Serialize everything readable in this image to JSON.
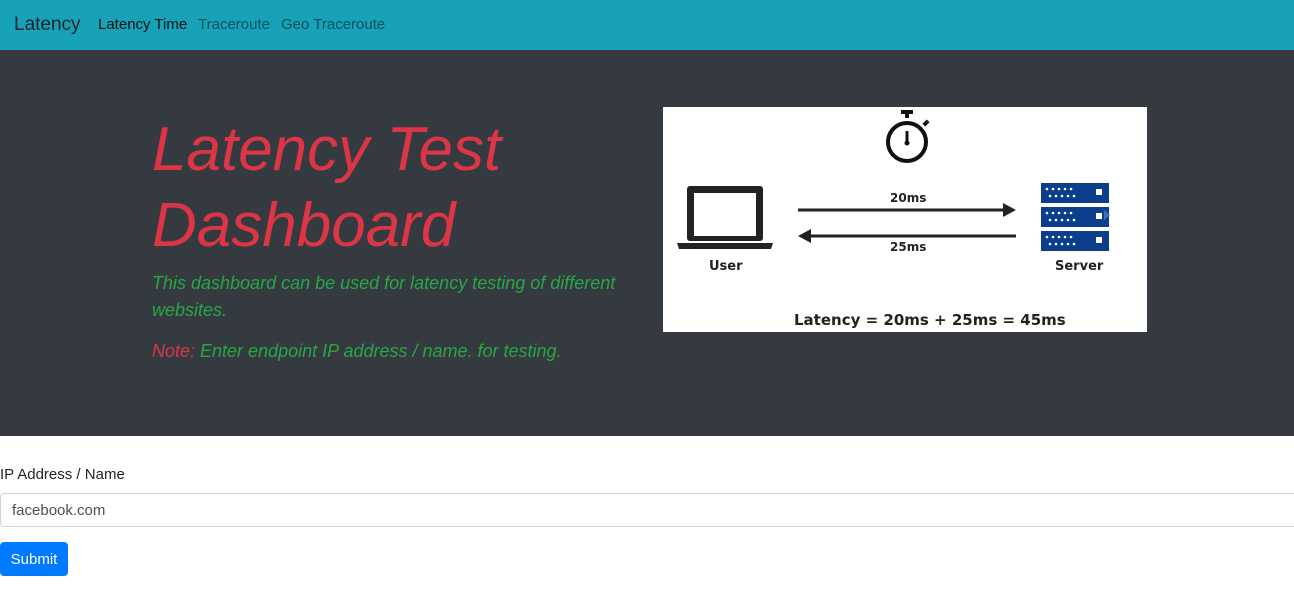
{
  "navbar": {
    "brand": "Latency",
    "links": [
      {
        "label": "Latency Time",
        "active": true
      },
      {
        "label": "Traceroute",
        "active": false
      },
      {
        "label": "Geo Traceroute",
        "active": false
      }
    ],
    "background": "#17a2b8"
  },
  "hero": {
    "title": "Latency Test Dashboard",
    "lead": "This dashboard can be used for latency testing of different websites.",
    "note_label": "Note:",
    "note_text": " Enter endpoint IP address / name. for testing.",
    "background": "#343a40",
    "title_color": "#dc3545",
    "text_color": "#28a745"
  },
  "diagram": {
    "user_label": "User",
    "server_label": "Server",
    "request_time": "20ms",
    "response_time": "25ms",
    "formula": "Latency = 20ms + 25ms = 45ms",
    "icons": [
      "stopwatch-icon",
      "laptop-icon",
      "server-icon"
    ]
  },
  "form": {
    "label": "IP Address / Name",
    "value": "facebook.com",
    "submit_label": "Submit",
    "submit_color": "#007bff"
  }
}
